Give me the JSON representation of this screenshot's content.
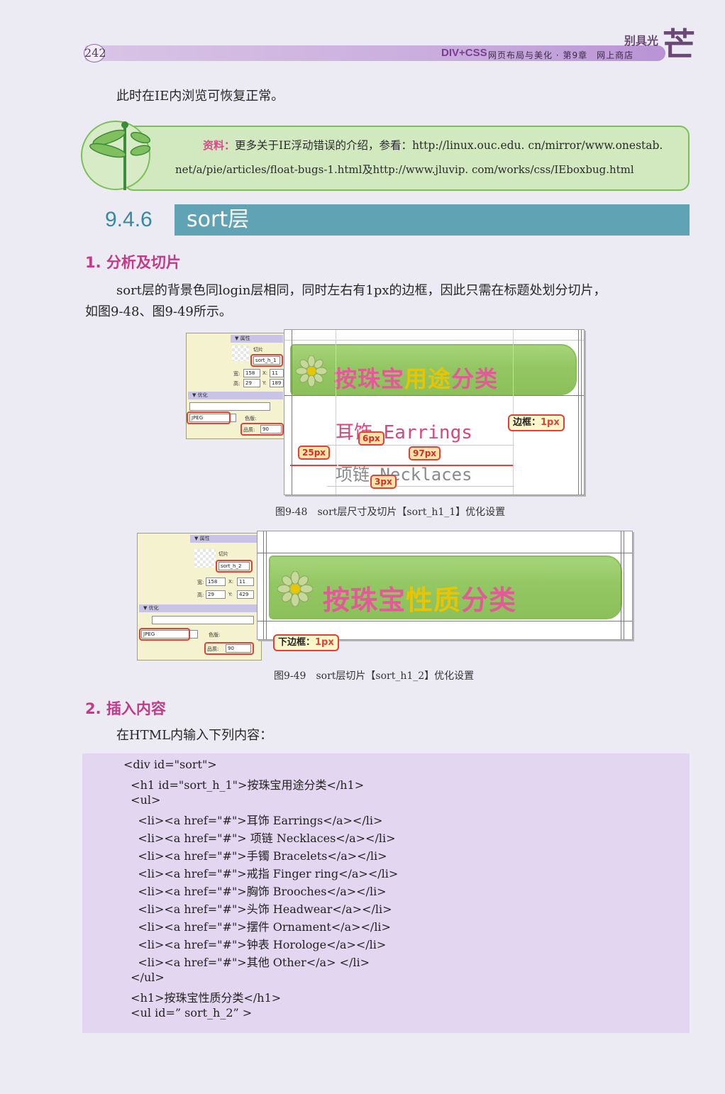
{
  "header": {
    "page_number": "242",
    "book": "DIV+CSS",
    "subtitle": "网页布局与美化 · 第9章　网上商店",
    "brand": "别具光",
    "brand_glyph": "芒"
  },
  "intro_text": "此时在IE内浏览可恢复正常。",
  "note": {
    "label": "资料：",
    "line1": "更多关于IE浮动错误的介绍，参看：http://linux.ouc.edu. cn/mirror/www.onestab.",
    "line2": "net/a/pie/articles/float-bugs-1.html及http://www.jluvip. com/works/css/IEboxbug.html"
  },
  "section": {
    "number": "9.4.6",
    "title": "sort层"
  },
  "subsection1": {
    "heading": "1. 分析及切片",
    "para_line1": "sort层的背景色同login层相同，同时左右有1px的边框，因此只需在标题处划分切片，",
    "para_line2": "如图9-48、图9-49所示。"
  },
  "figure48": {
    "panel": {
      "props_header": "▼ 属性",
      "slice_label": "切片",
      "slice_name": "sort_h_1",
      "w_label": "宽:",
      "w_value": "158",
      "x_label": "X:",
      "x_value": "11",
      "h_label": "高:",
      "h_value": "29",
      "y_label": "Y:",
      "y_value": "189",
      "opt_header": "▼ 优化",
      "format": "JPEG",
      "matte_label": "色版:",
      "quality_label": "品质:",
      "quality_value": "90"
    },
    "banner_text_a": "按珠宝",
    "banner_text_b": "用途",
    "banner_text_c": "分类",
    "item1": "耳饰 Earrings",
    "item2": "项链 Necklaces",
    "border_tag_label": "边框：",
    "border_tag_value": "1px",
    "dim_25": "25px",
    "dim_6": "6px",
    "dim_97": "97px",
    "dim_3": "3px",
    "caption": "图9-48　sort层尺寸及切片【sort_h1_1】优化设置"
  },
  "figure49": {
    "panel": {
      "props_header": "▼ 属性",
      "slice_label": "切片",
      "slice_name": "sort_h_2",
      "w_label": "宽:",
      "w_value": "158",
      "x_label": "X:",
      "x_value": "11",
      "h_label": "高:",
      "h_value": "29",
      "y_label": "Y:",
      "y_value": "429",
      "opt_header": "▼ 优化",
      "format": "JPEG",
      "matte_label": "色版:",
      "quality_label": "品质:",
      "quality_value": "90"
    },
    "banner_text_a": "按珠宝",
    "banner_text_b": "性质",
    "banner_text_c": "分类",
    "bottom_tag_label": "下边框：",
    "bottom_tag_value": "1px",
    "caption": "图9-49　sort层切片【sort_h1_2】优化设置"
  },
  "subsection2": {
    "heading": "2. 插入内容",
    "para": "在HTML内输入下列内容："
  },
  "code_lines": [
    "<div id=\"sort\">",
    "  <h1 id=\"sort_h_1\">按珠宝用途分类</h1>",
    "  <ul>",
    "    <li><a href=\"#\">耳饰 Earrings</a></li>",
    "    <li><a href=\"#\"> 项链 Necklaces</a></li>",
    "    <li><a href=\"#\">手镯 Bracelets</a></li>",
    "    <li><a href=\"#\">戒指 Finger ring</a></li>",
    "    <li><a href=\"#\">胸饰 Brooches</a></li>",
    "    <li><a href=\"#\">头饰 Headwear</a></li>",
    "    <li><a href=\"#\">摆件 Ornament</a></li>",
    "    <li><a href=\"#\">钟表 Horologe</a></li>",
    "    <li><a href=\"#\">其他 Other</a> </li>",
    "  </ul>",
    "  <h1>按珠宝性质分类</h1>",
    "  <ul id=” sort_h_2” >"
  ]
}
